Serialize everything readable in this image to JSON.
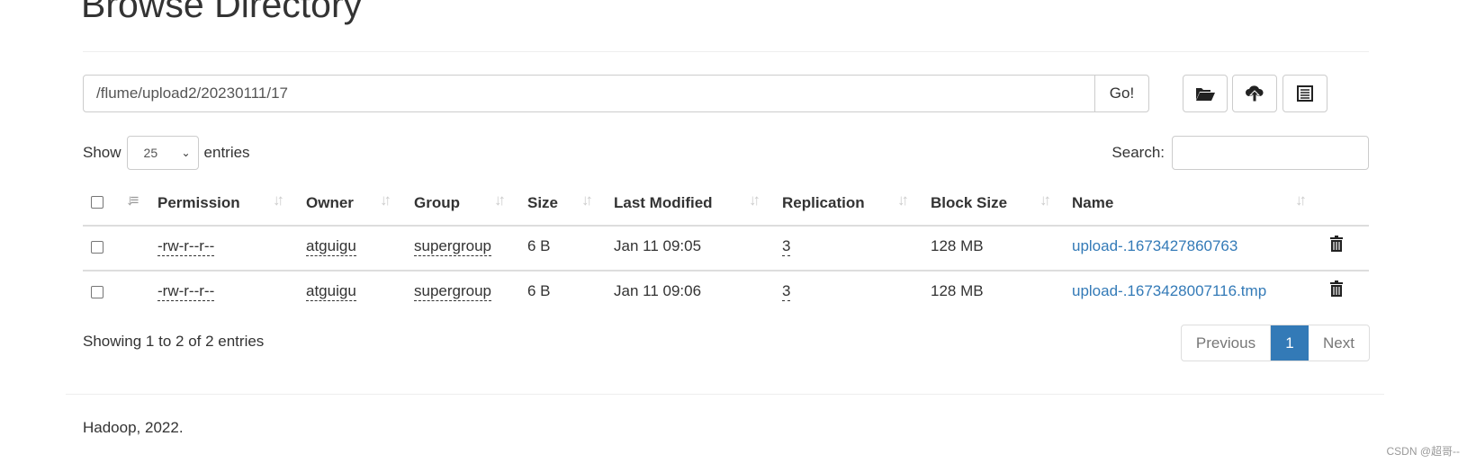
{
  "title": "Browse Directory",
  "path": {
    "value": "/flume/upload2/20230111/17",
    "go_label": "Go!"
  },
  "toolbar": {
    "icons": [
      "folder-open-icon",
      "cloud-upload-icon",
      "list-alt-icon"
    ]
  },
  "length": {
    "show_label": "Show",
    "value": "25",
    "entries_label": "entries"
  },
  "search": {
    "label": "Search:",
    "value": ""
  },
  "table": {
    "columns": [
      "Permission",
      "Owner",
      "Group",
      "Size",
      "Last Modified",
      "Replication",
      "Block Size",
      "Name"
    ],
    "rows": [
      {
        "permission": "-rw-r--r--",
        "owner": "atguigu",
        "group": "supergroup",
        "size": "6 B",
        "modified": "Jan 11 09:05",
        "replication": "3",
        "block_size": "128 MB",
        "name": "upload-.1673427860763"
      },
      {
        "permission": "-rw-r--r--",
        "owner": "atguigu",
        "group": "supergroup",
        "size": "6 B",
        "modified": "Jan 11 09:06",
        "replication": "3",
        "block_size": "128 MB",
        "name": "upload-.1673428007116.tmp"
      }
    ]
  },
  "info": "Showing 1 to 2 of 2 entries",
  "pagination": {
    "previous": "Previous",
    "current": "1",
    "next": "Next"
  },
  "footer": "Hadoop, 2022.",
  "watermark": "CSDN @超哥--",
  "colors": {
    "link": "#337ab7",
    "active_page": "#337ab7"
  }
}
